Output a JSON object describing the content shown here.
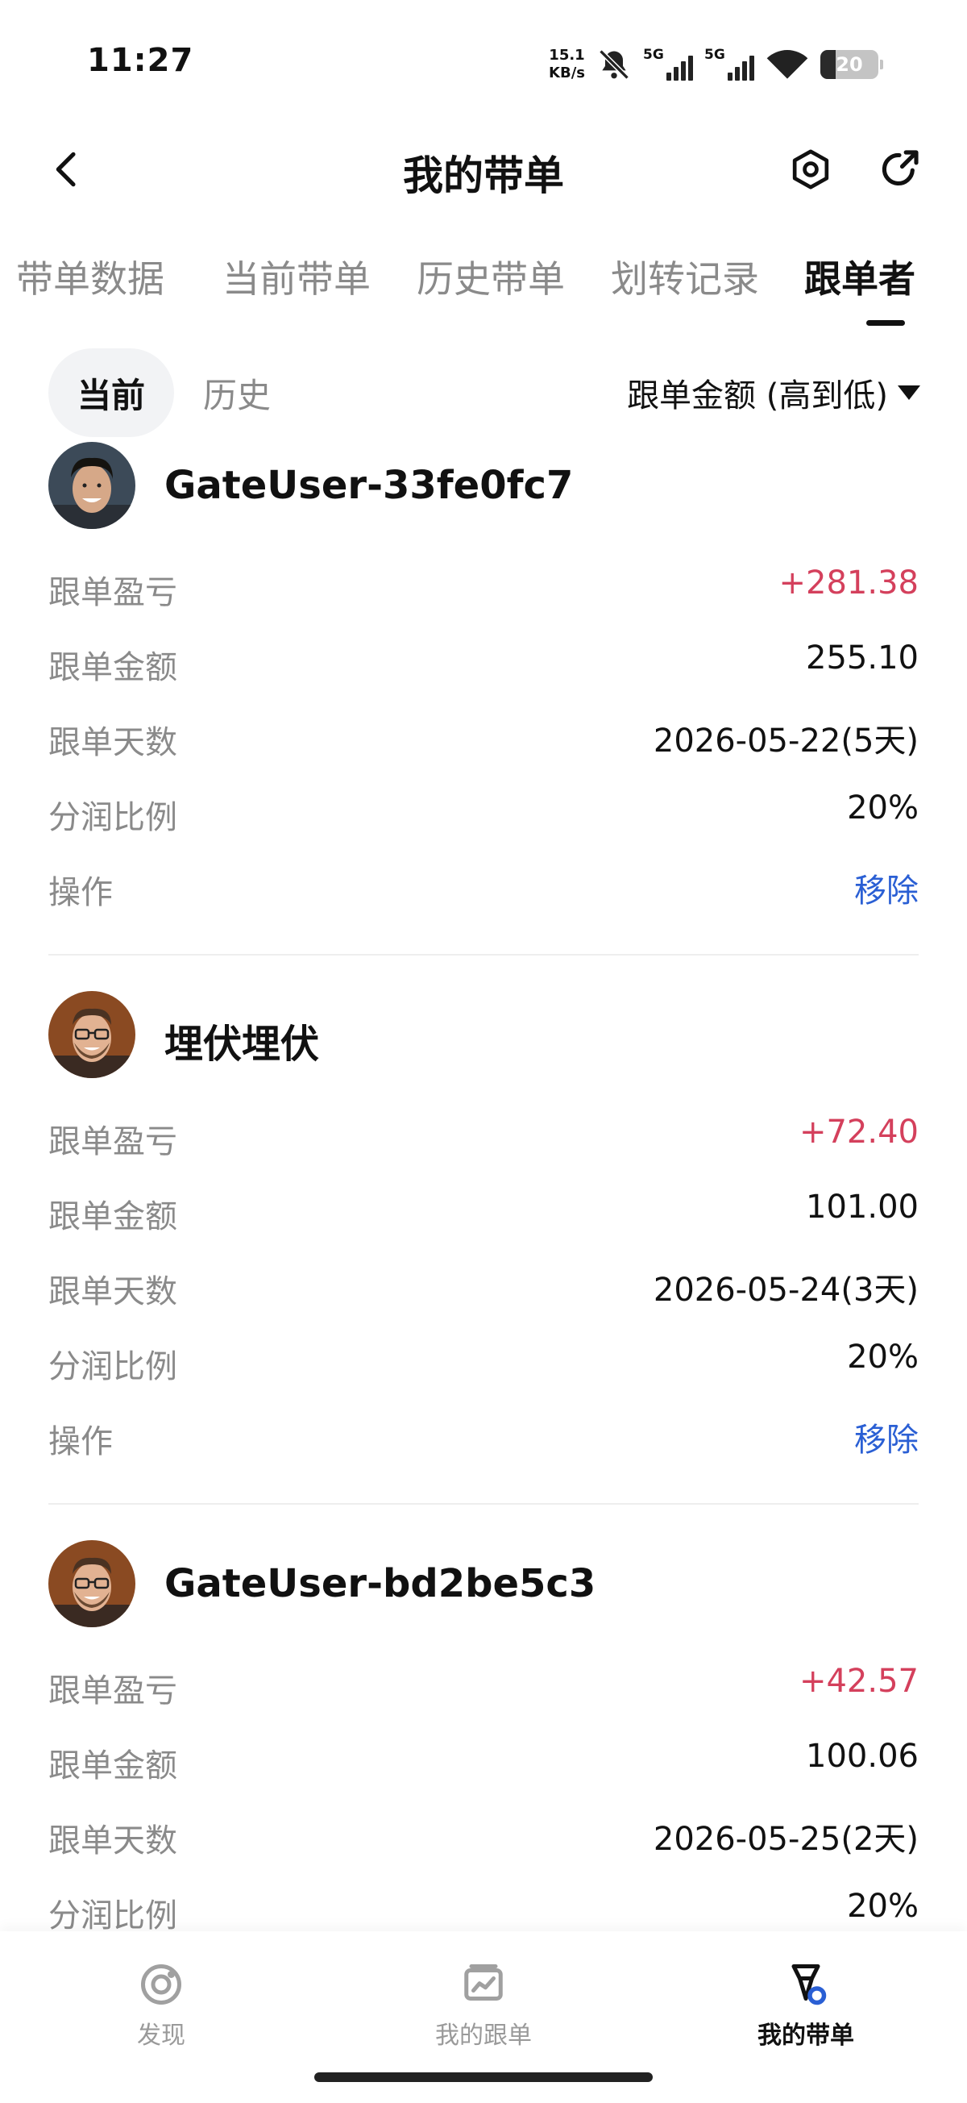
{
  "status_bar": {
    "time": "11:27",
    "net_speed_value": "15.1",
    "net_speed_unit": "KB/s",
    "sim1_label": "5G",
    "sim2_label": "5G",
    "battery": "20"
  },
  "header": {
    "title": "我的带单"
  },
  "tabs": [
    {
      "label": "带单数据"
    },
    {
      "label": "当前带单"
    },
    {
      "label": "历史带单"
    },
    {
      "label": "划转记录"
    },
    {
      "label": "跟单者"
    }
  ],
  "filter": {
    "current_label": "当前",
    "history_label": "历史",
    "sort_label": "跟单金额 (高到低)"
  },
  "followers": [
    {
      "name": "GateUser-33fe0fc7",
      "rows": [
        {
          "key": "跟单盈亏",
          "value": "+281.38",
          "type": "pos"
        },
        {
          "key": "跟单金额",
          "value": "255.10",
          "type": ""
        },
        {
          "key": "跟单天数",
          "value": "2026-05-22(5天)",
          "type": ""
        },
        {
          "key": "分润比例",
          "value": "20%",
          "type": ""
        },
        {
          "key": "操作",
          "value": "移除",
          "type": "link"
        }
      ]
    },
    {
      "name": "埋伏埋伏",
      "rows": [
        {
          "key": "跟单盈亏",
          "value": "+72.40",
          "type": "pos"
        },
        {
          "key": "跟单金额",
          "value": "101.00",
          "type": ""
        },
        {
          "key": "跟单天数",
          "value": "2026-05-24(3天)",
          "type": ""
        },
        {
          "key": "分润比例",
          "value": "20%",
          "type": ""
        },
        {
          "key": "操作",
          "value": "移除",
          "type": "link"
        }
      ]
    },
    {
      "name": "GateUser-bd2be5c3",
      "rows": [
        {
          "key": "跟单盈亏",
          "value": "+42.57",
          "type": "pos"
        },
        {
          "key": "跟单金额",
          "value": "100.06",
          "type": ""
        },
        {
          "key": "跟单天数",
          "value": "2026-05-25(2天)",
          "type": ""
        },
        {
          "key": "分润比例",
          "value": "20%",
          "type": ""
        }
      ]
    }
  ],
  "bottom_nav": [
    {
      "label": "发现",
      "icon": "discover-icon"
    },
    {
      "label": "我的跟单",
      "icon": "chart-board-icon"
    },
    {
      "label": "我的带单",
      "icon": "lead-trade-icon"
    }
  ],
  "colors": {
    "positive": "#d4405c",
    "link": "#2a5fd4",
    "muted": "#8a8a8a",
    "accent_blue": "#2a5fd4"
  }
}
